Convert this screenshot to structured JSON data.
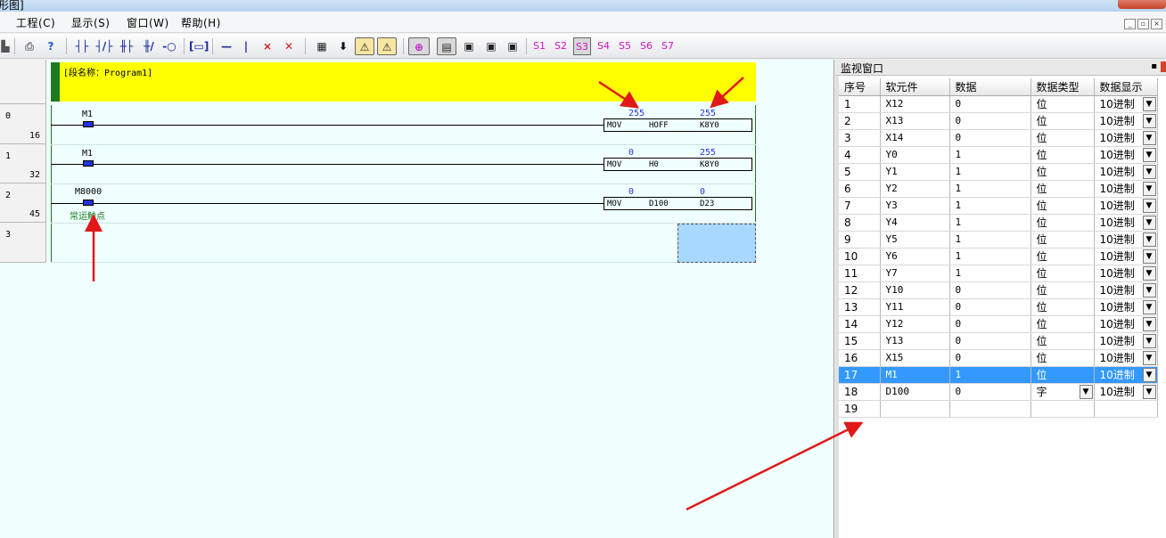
{
  "window": {
    "title_fragment": "形图]"
  },
  "menu": [
    {
      "label": "工程(C)"
    },
    {
      "label": "显示(S)"
    },
    {
      "label": "窗口(W)"
    },
    {
      "label": "帮助(H)"
    }
  ],
  "toolbar": {
    "sample_buttons": [
      "S1",
      "S2",
      "S3",
      "S4",
      "S5",
      "S6",
      "S7"
    ],
    "selected_sample": "S3"
  },
  "ladder": {
    "segment_name": "[段名称：Program1]",
    "rungs": [
      {
        "step": "0",
        "addr": "16",
        "contact": "M1",
        "comment": "",
        "op": "MOV",
        "src": "HOFF",
        "dst": "K8Y0",
        "src_val": "255",
        "dst_val": "255"
      },
      {
        "step": "1",
        "addr": "32",
        "contact": "M1",
        "comment": "",
        "op": "MOV",
        "src": "H0",
        "dst": "K8Y0",
        "src_val": "0",
        "dst_val": "255"
      },
      {
        "step": "2",
        "addr": "45",
        "contact": "M8000",
        "comment": "常运触点",
        "op": "MOV",
        "src": "D100",
        "dst": "D23",
        "src_val": "0",
        "dst_val": "0"
      },
      {
        "step": "3",
        "addr": ""
      }
    ]
  },
  "monitor": {
    "title": "监视窗口",
    "columns": [
      "序号",
      "软元件",
      "数据",
      "数据类型",
      "数据显示"
    ],
    "rows": [
      {
        "no": "1",
        "device": "X12",
        "value": "0",
        "type": "位",
        "display": "10进制"
      },
      {
        "no": "2",
        "device": "X13",
        "value": "0",
        "type": "位",
        "display": "10进制"
      },
      {
        "no": "3",
        "device": "X14",
        "value": "0",
        "type": "位",
        "display": "10进制"
      },
      {
        "no": "4",
        "device": "Y0",
        "value": "1",
        "type": "位",
        "display": "10进制"
      },
      {
        "no": "5",
        "device": "Y1",
        "value": "1",
        "type": "位",
        "display": "10进制"
      },
      {
        "no": "6",
        "device": "Y2",
        "value": "1",
        "type": "位",
        "display": "10进制"
      },
      {
        "no": "7",
        "device": "Y3",
        "value": "1",
        "type": "位",
        "display": "10进制"
      },
      {
        "no": "8",
        "device": "Y4",
        "value": "1",
        "type": "位",
        "display": "10进制"
      },
      {
        "no": "9",
        "device": "Y5",
        "value": "1",
        "type": "位",
        "display": "10进制"
      },
      {
        "no": "10",
        "device": "Y6",
        "value": "1",
        "type": "位",
        "display": "10进制"
      },
      {
        "no": "11",
        "device": "Y7",
        "value": "1",
        "type": "位",
        "display": "10进制"
      },
      {
        "no": "12",
        "device": "Y10",
        "value": "0",
        "type": "位",
        "display": "10进制"
      },
      {
        "no": "13",
        "device": "Y11",
        "value": "0",
        "type": "位",
        "display": "10进制"
      },
      {
        "no": "14",
        "device": "Y12",
        "value": "0",
        "type": "位",
        "display": "10进制"
      },
      {
        "no": "15",
        "device": "Y13",
        "value": "0",
        "type": "位",
        "display": "10进制"
      },
      {
        "no": "16",
        "device": "X15",
        "value": "0",
        "type": "位",
        "display": "10进制"
      },
      {
        "no": "17",
        "device": "M1",
        "value": "1",
        "type": "位",
        "display": "10进制",
        "selected": true
      },
      {
        "no": "18",
        "device": "D100",
        "value": "0",
        "type": "字",
        "display": "10进制",
        "type_dropdown": true
      },
      {
        "no": "19",
        "device": "",
        "value": "",
        "type": "",
        "display": ""
      }
    ]
  },
  "colors": {
    "segment_bar": "#ffff00",
    "editor_bg": "#f0ffff",
    "monitor_value": "#2a35d8",
    "selection": "#3399ff",
    "annotation_arrow": "#e01818"
  }
}
